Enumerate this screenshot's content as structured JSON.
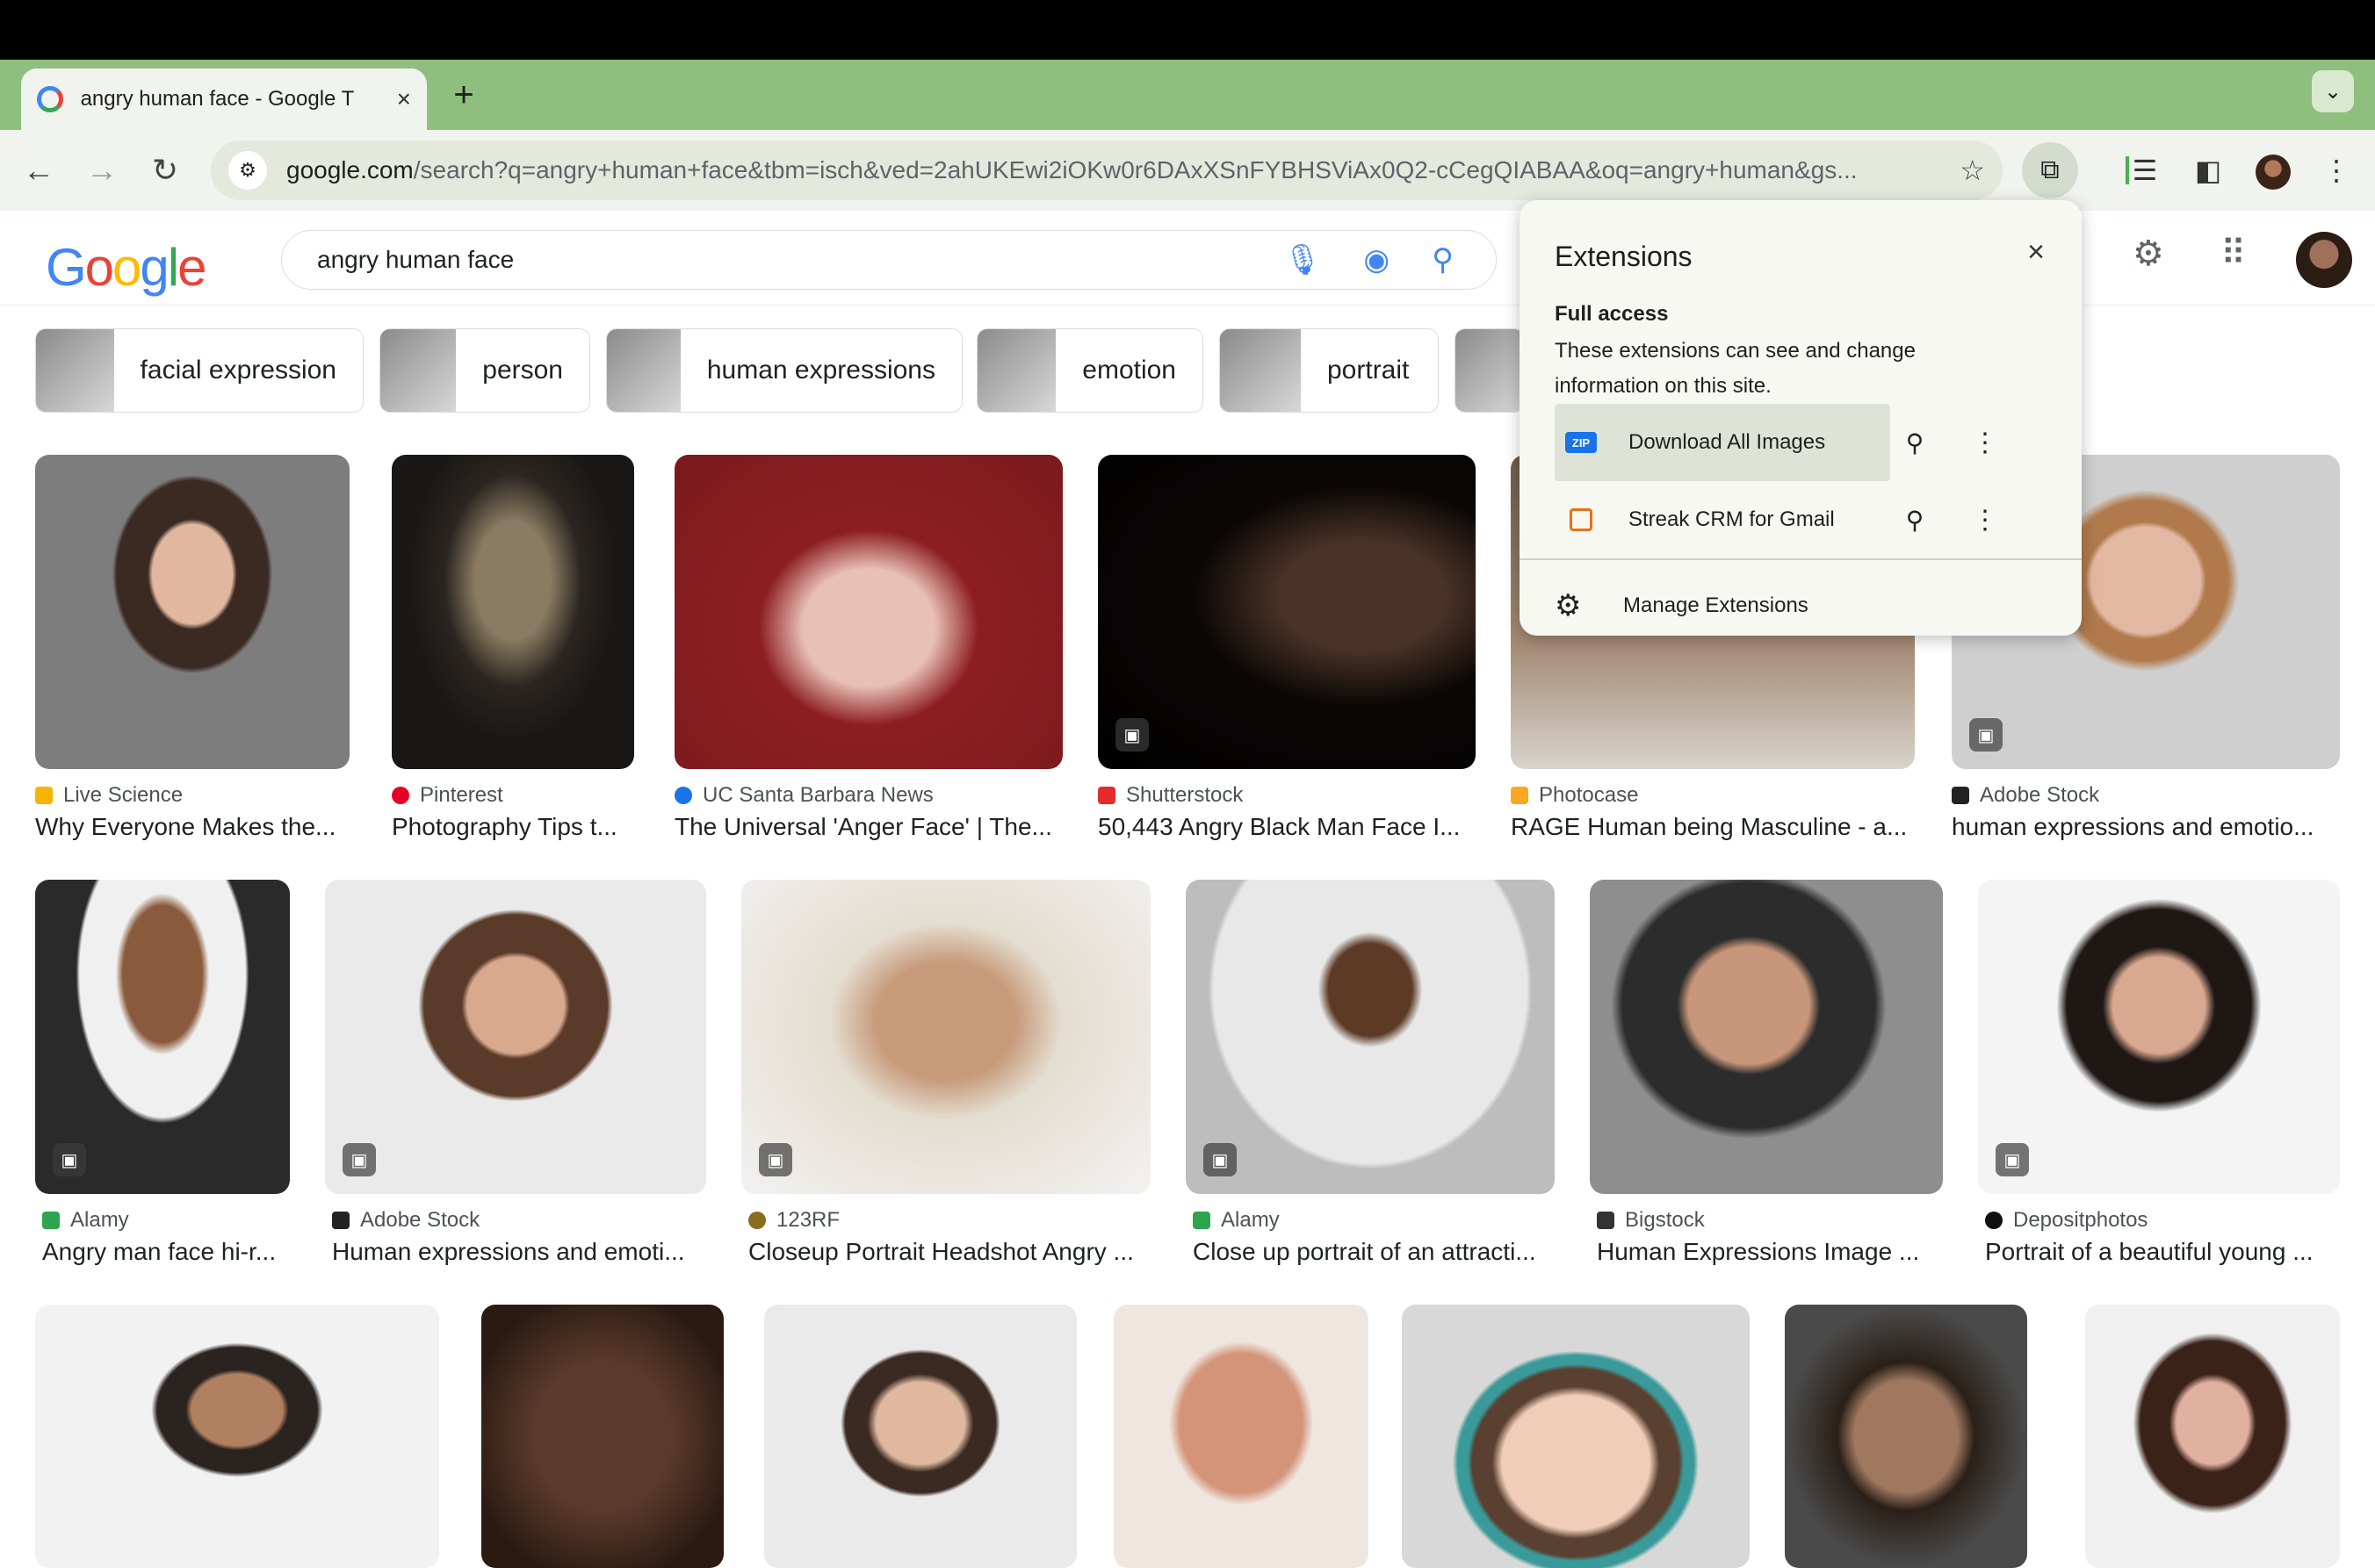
{
  "browser": {
    "tab_title": "angry human face - Google T",
    "tab_close": "×",
    "new_tab": "+",
    "url_domain": "google.com",
    "url_path": "/search?q=angry+human+face&tbm=isch&ved=2ahUKEwi2iOKw0r6DAxXSnFYBHSViAx0Q2-cCegQIABAA&oq=angry+human&gs..."
  },
  "search": {
    "logo": "Google",
    "query": "angry human face"
  },
  "chips": [
    {
      "label": "facial expression"
    },
    {
      "label": "person"
    },
    {
      "label": "human expressions"
    },
    {
      "label": "emotion"
    },
    {
      "label": "portrait"
    }
  ],
  "results": [
    {
      "source": "Live Science",
      "title": "Why Everyone Makes the...",
      "color": "#f4b400"
    },
    {
      "source": "Pinterest",
      "title": "Photography Tips t...",
      "color": "#e60023"
    },
    {
      "source": "UC Santa Barbara News",
      "title": "The Universal 'Anger Face' | The...",
      "color": "#1a73e8"
    },
    {
      "source": "Shutterstock",
      "title": "50,443 Angry Black Man Face I...",
      "color": "#e52b2b"
    },
    {
      "source": "Photocase",
      "title": "RAGE Human being Masculine - a...",
      "color": "#f9a825"
    },
    {
      "source": "Adobe Stock",
      "title": "human expressions and emotio...",
      "color": "#222222"
    },
    {
      "source": "Alamy",
      "title": "Angry man face hi-r...",
      "color": "#2ea44f"
    },
    {
      "source": "Adobe Stock",
      "title": "Human expressions and emoti...",
      "color": "#222222"
    },
    {
      "source": "123RF",
      "title": "Closeup Portrait Headshot Angry ...",
      "color": "#8a6d1d"
    },
    {
      "source": "Alamy",
      "title": "Close up portrait of an attracti...",
      "color": "#2ea44f"
    },
    {
      "source": "Bigstock",
      "title": "Human Expressions Image ...",
      "color": "#333333"
    },
    {
      "source": "Depositphotos",
      "title": "Portrait of a beautiful young ...",
      "color": "#111111"
    }
  ],
  "extensions_popup": {
    "title": "Extensions",
    "close": "×",
    "full_access": "Full access",
    "description": "These extensions can see and change information on this site.",
    "items": [
      {
        "name": "Download All Images",
        "icon_text": "ZIP",
        "icon_color": "#1a73e8"
      },
      {
        "name": "Streak CRM for Gmail",
        "icon_text": "",
        "icon_color": "#e8711a"
      }
    ],
    "manage": "Manage Extensions"
  }
}
